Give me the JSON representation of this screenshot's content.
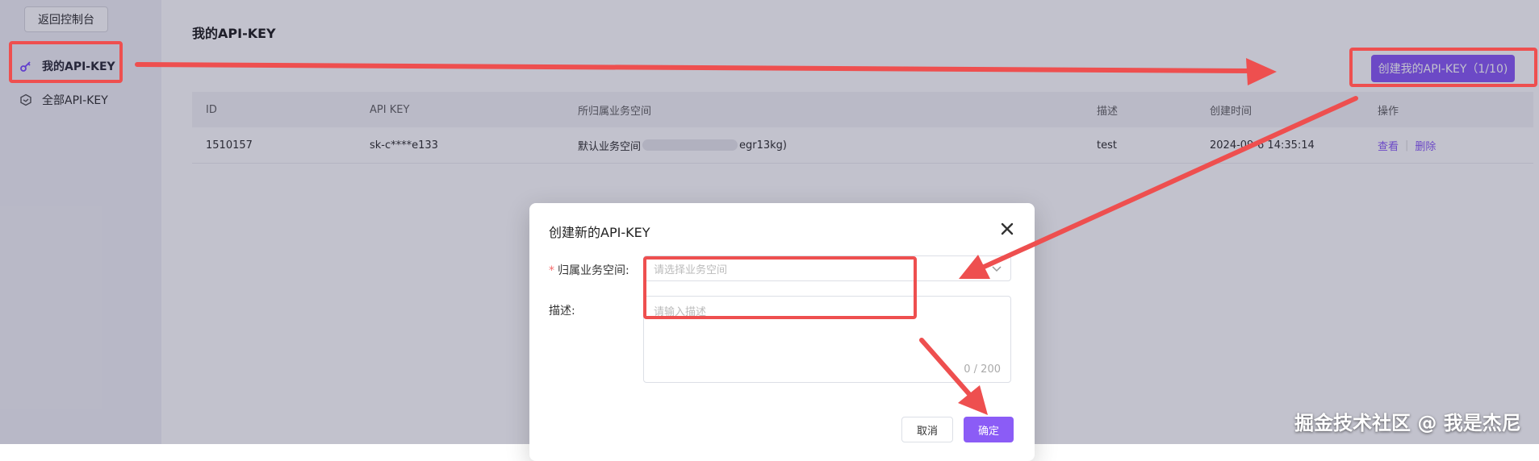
{
  "sidebar": {
    "back_label": "返回控制台",
    "items": [
      {
        "label": "我的API-KEY",
        "icon": "key-icon",
        "active": true
      },
      {
        "label": "全部API-KEY",
        "icon": "cube-icon",
        "active": false
      }
    ]
  },
  "page": {
    "title": "我的API-KEY",
    "create_button": "创建我的API-KEY（1/10)"
  },
  "table": {
    "columns": [
      "ID",
      "API KEY",
      "所归属业务空间",
      "描述",
      "创建时间",
      "操作"
    ],
    "rows": [
      {
        "id": "1510157",
        "api_key": "sk-c****e133",
        "workspace_prefix": "默认业务空间",
        "workspace_suffix": "egr13kg)",
        "description": "test",
        "created_prefix": "2024-09-",
        "created_suffix": "6 14:35:14",
        "op_view": "查看",
        "op_delete": "删除"
      }
    ]
  },
  "modal": {
    "title": "创建新的API-KEY",
    "workspace_label": "归属业务空间:",
    "workspace_placeholder": "请选择业务空间",
    "description_label": "描述:",
    "description_placeholder": "请输入描述",
    "counter": "0 / 200",
    "cancel_label": "取消",
    "ok_label": "确定"
  },
  "colors": {
    "accent": "#8b5cf6",
    "annotation_red": "#ee4f4f",
    "required_star": "#f56c6c"
  },
  "watermark": "掘金技术社区 @ 我是杰尼"
}
